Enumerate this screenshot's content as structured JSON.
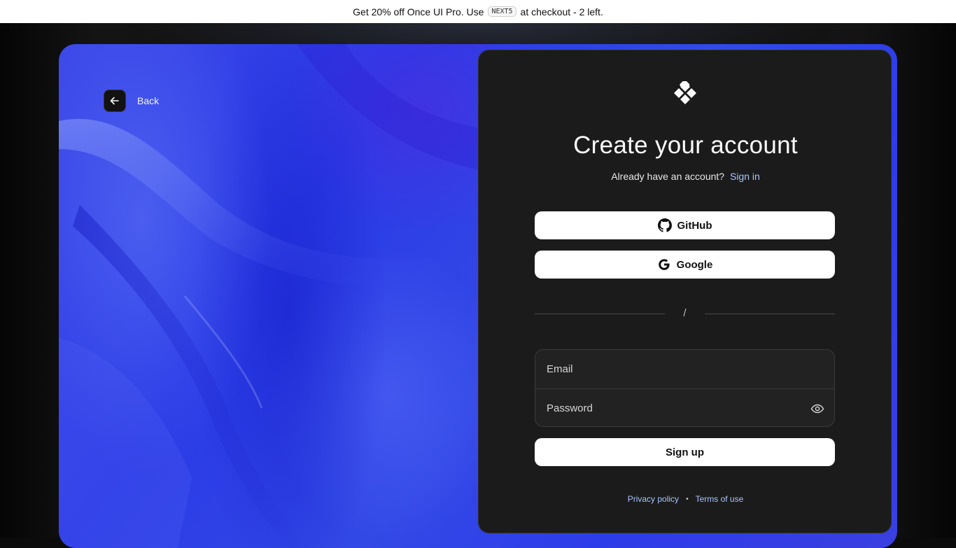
{
  "promo": {
    "text_before": "Get 20% off Once UI Pro. Use",
    "code": "NEXT5",
    "text_after": "at checkout - 2 left."
  },
  "back": {
    "label": "Back",
    "icon": "arrow-left-icon"
  },
  "card": {
    "logo_icon": "once-ui-logo-icon",
    "title": "Create your account",
    "subtitle": "Already have an account?",
    "signin_link": "Sign in",
    "github_label": "GitHub",
    "google_label": "Google",
    "divider": "/",
    "email_placeholder": "Email",
    "password_placeholder": "Password",
    "signup_label": "Sign up",
    "privacy_label": "Privacy policy",
    "separator": "•",
    "terms_label": "Terms of use"
  },
  "colors": {
    "accent_link": "#a9c4ff",
    "card_bg": "#1b1b1b",
    "frame_blue": "#2d3ce9"
  }
}
